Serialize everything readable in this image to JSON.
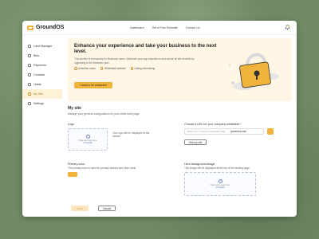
{
  "app": {
    "name": "GroundOS"
  },
  "nav": [
    "Dashboard",
    "Get a Free Estimate",
    "Contact Us"
  ],
  "sidebar": {
    "items": [
      {
        "label": "Land Manager",
        "icon": "map-icon"
      },
      {
        "label": "Bids",
        "icon": "gavel-icon"
      },
      {
        "label": "Payments",
        "icon": "card-icon"
      },
      {
        "label": "Contacts",
        "icon": "contacts-icon"
      },
      {
        "label": "Leads",
        "icon": "leads-icon"
      },
      {
        "label": "My Site",
        "icon": "globe-icon",
        "active": true
      },
      {
        "label": "Settings",
        "icon": "gear-icon"
      }
    ]
  },
  "banner": {
    "title": "Enhance your experience and take your business to the next level.",
    "description": "This section is exclusively for Business users. Maximize your app experience and unlock all the benefits by upgrading to the Business plan.",
    "perks": [
      "Unlimited users",
      "Whitelabel website",
      "Listing Advertising"
    ],
    "cta": "I want to be contacted"
  },
  "site": {
    "title": "My site",
    "subtitle": "Manage your general configurations for your white-label page",
    "logo_label": "Logo",
    "logo_hint": "Your logo will be displayed at the header",
    "upload_text": "Drag your logo here",
    "upload_or": "or Upload",
    "url_label": "Choose a URL for your company whitelabel *",
    "url_placeholder": "Enter your company whitelabel URL",
    "url_suffix": "groundos.com",
    "visit_label": "Visit my site",
    "primary_color_label": "Primary color",
    "primary_color_hint": "The primary color is used for primary actions and other parts",
    "primary_color": "#f0b43c",
    "hero_label": "Hero background image",
    "hero_hint": "This image will be displayed at the top of the landing page",
    "hero_upload_text": "Drag your image here",
    "hero_upload_or": "or Upload",
    "save_label": "Save",
    "cancel_label": "Cancel"
  }
}
